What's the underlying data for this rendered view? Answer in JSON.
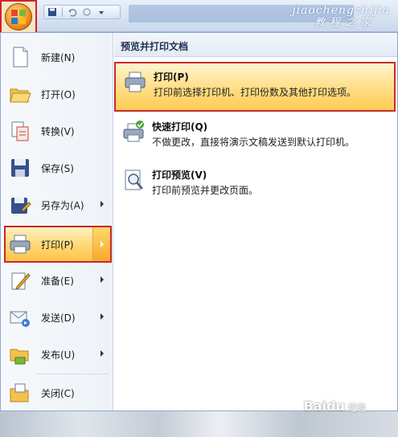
{
  "watermark": {
    "line1": "jiaochengzhijia",
    "line2": "教程之家"
  },
  "left_menu": [
    {
      "label": "新建(N)",
      "icon": "new-document-icon",
      "has_submenu": false
    },
    {
      "label": "打开(O)",
      "icon": "open-folder-icon",
      "has_submenu": false
    },
    {
      "label": "转换(V)",
      "icon": "convert-icon",
      "has_submenu": false
    },
    {
      "label": "保存(S)",
      "icon": "save-disk-icon",
      "has_submenu": false
    },
    {
      "label": "另存为(A)",
      "icon": "save-as-icon",
      "has_submenu": true
    },
    {
      "label": "打印(P)",
      "icon": "printer-icon",
      "has_submenu": true,
      "active": true
    },
    {
      "label": "准备(E)",
      "icon": "prepare-pen-icon",
      "has_submenu": true
    },
    {
      "label": "发送(D)",
      "icon": "send-icon",
      "has_submenu": true
    },
    {
      "label": "发布(U)",
      "icon": "publish-icon",
      "has_submenu": true
    },
    {
      "label": "关闭(C)",
      "icon": "close-folder-icon",
      "has_submenu": false
    }
  ],
  "right_panel": {
    "header": "预览并打印文档",
    "items": [
      {
        "title": "打印(P)",
        "desc": "打印前选择打印机、打印份数及其他打印选项。",
        "icon": "printer-icon",
        "highlighted": true
      },
      {
        "title": "快速打印(Q)",
        "desc": "不做更改，直接将演示文稿发送到默认打印机。",
        "icon": "quick-print-icon"
      },
      {
        "title": "打印预览(V)",
        "desc": "打印前预览并更改页面。",
        "icon": "print-preview-icon"
      }
    ]
  },
  "footer": {
    "brand": "Baidu",
    "brand_suffix": "经验"
  },
  "colors": {
    "highlight_border": "#c62a2a",
    "highlight_fill": "#ffd772",
    "accent_orange": "#f08a1c"
  }
}
